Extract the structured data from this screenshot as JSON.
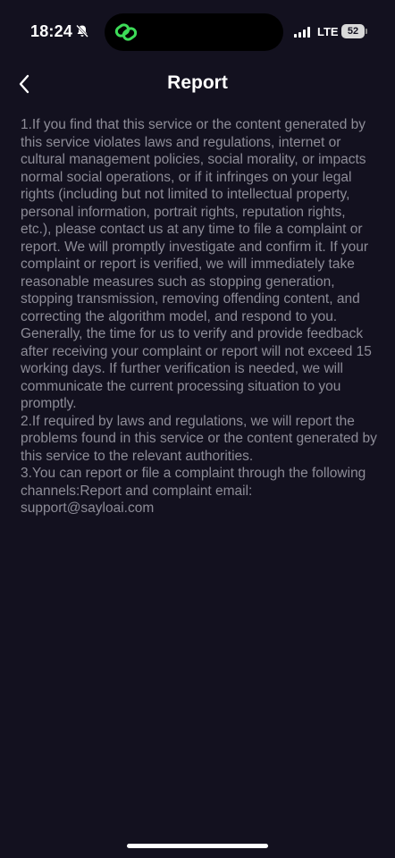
{
  "status_bar": {
    "time": "18:24",
    "network": "LTE",
    "battery": "52",
    "icons": {
      "silent": "bell-slash-icon",
      "app": "link-icon",
      "signal": "signal-icon"
    }
  },
  "header": {
    "title": "Report",
    "back_icon": "chevron-left-icon"
  },
  "content": {
    "paragraphs": [
      "1.If you find that this service or the content generated by this service violates laws and regulations, internet or cultural management policies, social morality, or impacts normal social operations, or if it infringes on your legal rights (including but not limited to intellectual property, personal information, portrait rights, reputation rights, etc.), please contact us at any time to file a complaint or report. We will promptly investigate and confirm it. If your complaint or report is verified, we will immediately take reasonable measures such as stopping generation, stopping transmission, removing offending content, and correcting the algorithm model, and respond to you. Generally, the time for us to verify and provide feedback after receiving your complaint or report will not exceed 15 working days. If further verification is needed, we will communicate the current processing situation to you promptly.",
      "2.If required by laws and regulations, we will report the problems found in this service or the content generated by this service to the relevant authorities.",
      "3.You can report or file a complaint through the following channels:Report and complaint email: support@sayloai.com"
    ]
  },
  "colors": {
    "background": "#13111f",
    "body_text": "#8d8c97",
    "accent_green": "#3ddc58"
  }
}
